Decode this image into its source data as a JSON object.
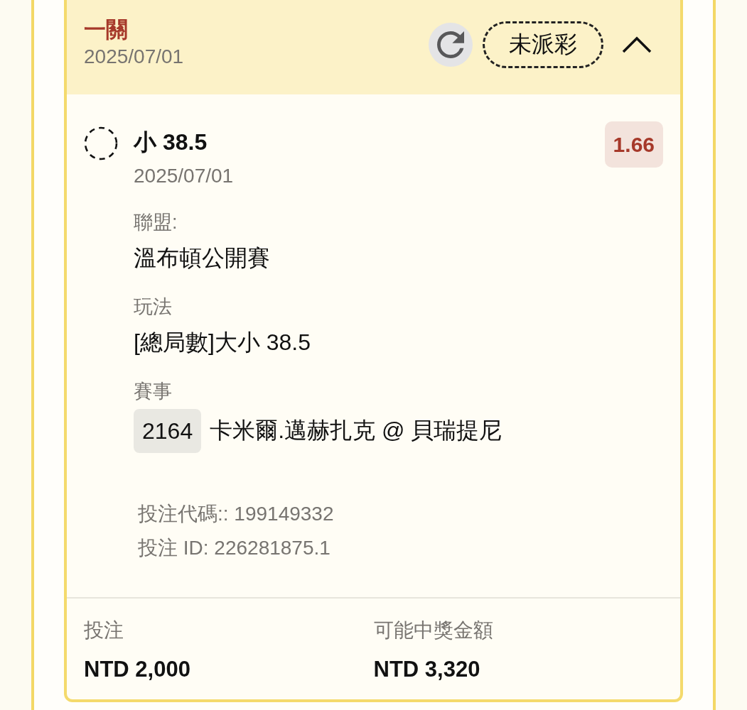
{
  "bet": {
    "type": "一關",
    "date": "2025/07/01",
    "status": "未派彩",
    "expanded": true
  },
  "selection": {
    "pick": "小 38.5",
    "date": "2025/07/01",
    "odds": "1.66"
  },
  "details": [
    {
      "kind": "text",
      "label": "聯盟:",
      "value": "溫布頓公開賽"
    },
    {
      "kind": "text",
      "label": "玩法",
      "value": "[總局數]大小 38.5"
    },
    {
      "kind": "match",
      "label": "賽事",
      "number": "2164",
      "value": "卡米爾.邁赫扎克 @ 貝瑞提尼"
    }
  ],
  "references": [
    "投注代碼:: 199149332",
    "投注 ID: 226281875.1"
  ],
  "summary": [
    {
      "label": "投注",
      "value": "NTD 2,000"
    },
    {
      "label": "可能中獎金額",
      "value": "NTD 3,320"
    }
  ]
}
